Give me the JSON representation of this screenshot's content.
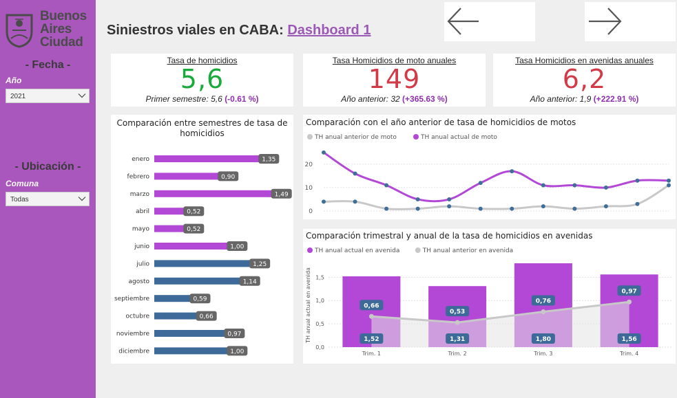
{
  "sidebar": {
    "logo": {
      "line1": "Buenos",
      "line2": "Aires",
      "line3": "Ciudad"
    },
    "fecha_title": "- Fecha -",
    "year_label": "Año",
    "year_value": "2021",
    "ubicacion_title": "- Ubicación -",
    "comuna_label": "Comuna",
    "comuna_value": "Todas"
  },
  "header": {
    "title": "Siniestros viales en CABA:",
    "link": "Dashboard 1",
    "back_icon": "arrow-left-icon",
    "forward_icon": "arrow-right-icon"
  },
  "kpis": [
    {
      "title": "Tasa de homicidios",
      "value": "5,6",
      "color": "#1aaa3c",
      "sub_label": "Primer semestre:",
      "sub_value": "5,6",
      "sub_delta": "(-0.61 %)"
    },
    {
      "title": "Tasa Homicidios de moto anuales",
      "value": "149",
      "color": "#d13b47",
      "sub_label": "Año anterior:",
      "sub_value": "32",
      "sub_delta": "(+365.63 %)"
    },
    {
      "title": "Tasa Homicidios en avenidas anuales",
      "value": "6,2",
      "color": "#d13b47",
      "sub_label": "Año anterior:",
      "sub_value": "1,9",
      "sub_delta": "(+222.91 %)"
    }
  ],
  "colors": {
    "purple": "#b347d6",
    "blue": "#3d6a99",
    "gray": "#c8c8c8",
    "sidebar": "#a957bd",
    "dot": "#3f6e99"
  },
  "chart_data": [
    {
      "type": "bar",
      "orientation": "horizontal",
      "title": "Comparación entre semestres de tasa de homicidios",
      "categories": [
        "enero",
        "febrero",
        "marzo",
        "abril",
        "mayo",
        "junio",
        "julio",
        "agosto",
        "septiembre",
        "octubre",
        "noviembre",
        "diciembre"
      ],
      "values": [
        1.35,
        0.9,
        1.49,
        0.52,
        0.52,
        1.0,
        1.25,
        1.14,
        0.59,
        0.66,
        0.97,
        1.0
      ],
      "labels": [
        "1,35",
        "0,90",
        "1,49",
        "0,52",
        "0,52",
        "1,00",
        "1,25",
        "1,14",
        "0,59",
        "0,66",
        "0,97",
        "1,00"
      ],
      "bar_colors": [
        "purple",
        "purple",
        "purple",
        "purple",
        "purple",
        "purple",
        "blue",
        "blue",
        "blue",
        "blue",
        "blue",
        "blue"
      ],
      "xlim": [
        0,
        1.5
      ]
    },
    {
      "type": "line",
      "title": "Comparación con el año anterior de tasa de homicidios de motos",
      "series": [
        {
          "name": "TH anual anterior de moto",
          "color": "gray",
          "values": [
            4,
            4,
            1,
            1,
            2,
            1,
            1,
            2,
            1,
            2,
            3,
            11
          ]
        },
        {
          "name": "TH anual actual de moto",
          "color": "purple",
          "values": [
            25,
            16,
            11,
            5,
            5,
            12,
            17,
            11,
            11,
            10,
            13,
            13
          ]
        }
      ],
      "yticks": [
        "0",
        "10",
        "20"
      ],
      "ylim": [
        0,
        27
      ],
      "grid": true
    },
    {
      "type": "bar",
      "title": "Comparación trimestral y anual de la tasa de homicidios en avenidas",
      "categories": [
        "Trim. 1",
        "Trim. 2",
        "Trim. 3",
        "Trim. 4"
      ],
      "ylabel": "TH anual actual en avenida",
      "yticks": [
        "0,0",
        "0,5",
        "1,0",
        "1,5"
      ],
      "ylim": [
        0,
        1.8
      ],
      "series": [
        {
          "name": "TH anual actual en avenida",
          "color": "purple",
          "values": [
            1.52,
            1.31,
            1.8,
            1.56
          ],
          "labels": [
            "1,52",
            "1,31",
            "1,80",
            "1,56"
          ]
        },
        {
          "name": "TH anual anterior en avenida",
          "color": "gray",
          "values": [
            0.66,
            0.53,
            0.76,
            0.97
          ],
          "labels": [
            "0,66",
            "0,53",
            "0,76",
            "0,97"
          ]
        }
      ]
    }
  ]
}
